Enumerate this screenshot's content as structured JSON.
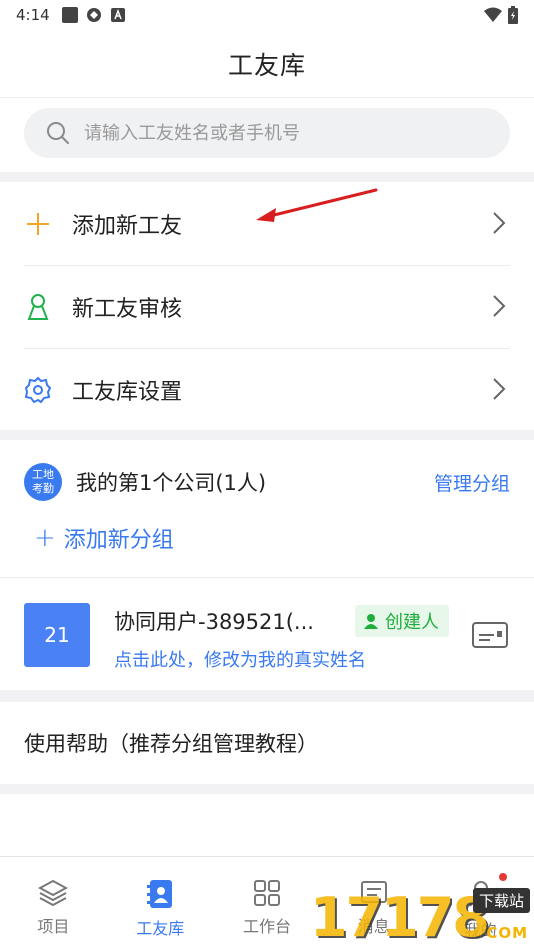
{
  "status_bar": {
    "time": "4:14"
  },
  "header": {
    "title": "工友库"
  },
  "search": {
    "placeholder": "请输入工友姓名或者手机号"
  },
  "menu": {
    "items": [
      {
        "label": "添加新工友",
        "icon": "plus-icon",
        "color": "#f5a623"
      },
      {
        "label": "新工友审核",
        "icon": "person-icon",
        "color": "#22b14c"
      },
      {
        "label": "工友库设置",
        "icon": "gear-icon",
        "color": "#3a7af0"
      }
    ]
  },
  "company": {
    "badge_line1": "工地",
    "badge_line2": "考勤",
    "name": "我的第1个公司(1人)",
    "manage_label": "管理分组",
    "add_group_label": "添加新分组"
  },
  "user": {
    "avatar_text": "21",
    "name": "协同用户-389521(...",
    "role_badge": "创建人",
    "hint": "点击此处，修改为我的真实姓名"
  },
  "help": {
    "label": "使用帮助（推荐分组管理教程）"
  },
  "tabbar": {
    "tabs": [
      {
        "label": "项目",
        "icon": "layers-icon",
        "active": false
      },
      {
        "label": "工友库",
        "icon": "contacts-book-icon",
        "active": true
      },
      {
        "label": "工作台",
        "icon": "grid-icon",
        "active": false
      },
      {
        "label": "消息",
        "icon": "message-icon",
        "active": false
      },
      {
        "label": "我的",
        "icon": "profile-icon",
        "active": false
      }
    ]
  },
  "watermark": {
    "number": "17178",
    "chip": "下载站",
    "domain": "COM"
  },
  "colors": {
    "accent": "#3a7af0",
    "creator_green": "#1fae3d",
    "plus_orange": "#f5a623",
    "arrow_red": "#d81e1e"
  }
}
